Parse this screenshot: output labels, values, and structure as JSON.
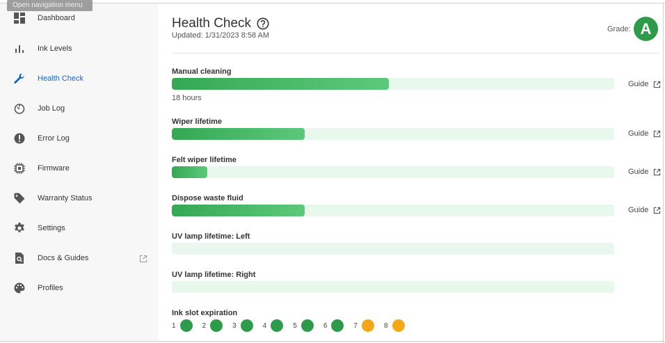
{
  "tooltip": "Open navigation menu",
  "sidebar": {
    "items": [
      {
        "label": "Dashboard",
        "icon": "dashboard-icon"
      },
      {
        "label": "Ink Levels",
        "icon": "bar-chart-icon"
      },
      {
        "label": "Health Check",
        "icon": "wrench-icon",
        "active": true
      },
      {
        "label": "Job Log",
        "icon": "timer-icon"
      },
      {
        "label": "Error Log",
        "icon": "error-icon"
      },
      {
        "label": "Firmware",
        "icon": "chip-icon"
      },
      {
        "label": "Warranty Status",
        "icon": "tag-icon"
      },
      {
        "label": "Settings",
        "icon": "gear-icon"
      },
      {
        "label": "Docs & Guides",
        "icon": "doc-search-icon",
        "external": true
      },
      {
        "label": "Profiles",
        "icon": "palette-icon"
      }
    ]
  },
  "header": {
    "title": "Health Check",
    "updated": "Updated: 1/31/2023 8:58 AM",
    "grade_label": "Grade:",
    "grade": "A"
  },
  "metrics": [
    {
      "label": "Manual cleaning",
      "progress": 0.49,
      "sub": "18 hours",
      "guide": "Guide"
    },
    {
      "label": "Wiper lifetime",
      "progress": 0.3,
      "guide": "Guide"
    },
    {
      "label": "Felt wiper lifetime",
      "progress": 0.08,
      "guide": "Guide"
    },
    {
      "label": "Dispose waste fluid",
      "progress": 0.3,
      "guide": "Guide"
    },
    {
      "label": "UV lamp lifetime: Left",
      "progress": 0
    },
    {
      "label": "UV lamp lifetime: Right",
      "progress": 0
    }
  ],
  "ink_slots": {
    "label": "Ink slot expiration",
    "slots": [
      {
        "num": "1",
        "color": "#2e9b4a"
      },
      {
        "num": "2",
        "color": "#2e9b4a"
      },
      {
        "num": "3",
        "color": "#2e9b4a"
      },
      {
        "num": "4",
        "color": "#2e9b4a"
      },
      {
        "num": "5",
        "color": "#2e9b4a"
      },
      {
        "num": "6",
        "color": "#2e9b4a"
      },
      {
        "num": "7",
        "color": "#f2a818"
      },
      {
        "num": "8",
        "color": "#f2a818"
      }
    ]
  },
  "colors": {
    "accent": "#1565c0",
    "ok": "#2e9b4a",
    "warn": "#f2a818",
    "track": "#e9f8ed"
  }
}
